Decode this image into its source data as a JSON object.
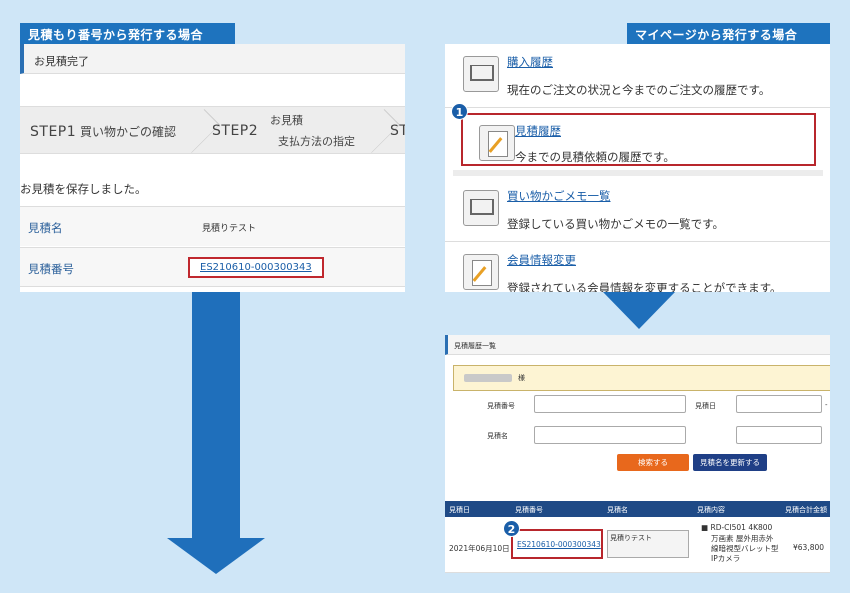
{
  "left_tag": "見積もり番号から発行する場合",
  "right_tag": "マイページから発行する場合",
  "left_panel": {
    "header": "お見積完了",
    "step1": {
      "num": "STEP1",
      "label": "買い物かごの確認"
    },
    "step2": {
      "num": "STEP2",
      "label_top": "お見積",
      "label_bottom": "支払方法の指定"
    },
    "step3": {
      "num": "ST"
    },
    "message": "お見積を保存しました。",
    "row_name_label": "見積名",
    "row_name_value": "見積りテスト",
    "row_number_label": "見積番号",
    "row_number_value": "ES210610-000300343"
  },
  "menu": {
    "items": [
      {
        "title": "購入履歴",
        "desc": "現在のご注文の状況と今までのご注文の履歴です。"
      },
      {
        "title": "見積履歴",
        "desc": "今までの見積依頼の履歴です。"
      },
      {
        "title": "買い物かごメモ一覧",
        "desc": "登録している買い物かごメモの一覧です。"
      },
      {
        "title": "会員情報変更",
        "desc": "登録されている会員情報を変更することができます。"
      }
    ],
    "badge1": "1"
  },
  "history": {
    "header": "見積履歴一覧",
    "sama": "様",
    "label_number": "見積番号",
    "label_date": "見積日",
    "label_name": "見積名",
    "date_dash": "-",
    "btn_search": "検索する",
    "btn_update": "見積名を更新する",
    "columns": [
      "見積日",
      "見積番号",
      "見積名",
      "見積内容",
      "見積合計金額"
    ],
    "row": {
      "date": "2021年06月10日",
      "number": "ES210610-000300343",
      "name": "見積りテスト",
      "content_1": "RD-CI501 4K800",
      "content_2": "万画素 屋外用赤外",
      "content_3": "線暗視型バレット型",
      "content_4": "IPカメラ",
      "total": "¥63,800"
    },
    "badge2": "2"
  }
}
